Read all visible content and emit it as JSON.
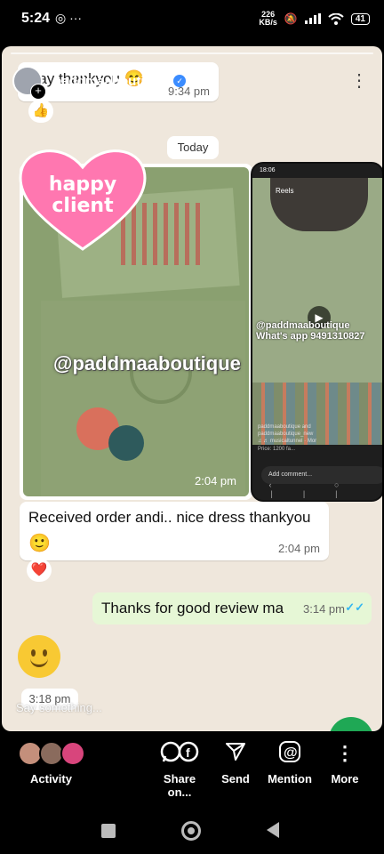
{
  "status_bar": {
    "time": "5:24",
    "left_icons": "◎ ···",
    "net_speed_value": "226",
    "net_speed_unit": "KB/s",
    "battery": "41"
  },
  "story_header": {
    "username": "paddmaaboutique",
    "time_ago": "1m",
    "verified": "✓"
  },
  "chat": {
    "prev_text": "Say thankyou",
    "prev_emoji": "😊",
    "prev_time": "9:34 pm",
    "prev_reaction": "👍",
    "date_chip": "Today",
    "sticker_text_line1": "happy",
    "sticker_text_line2": "client",
    "watermark": "@paddmaaboutique",
    "photo_time": "2:04 pm",
    "message_text": "Received order andi.. nice dress thankyou",
    "message_emoji": "🙂",
    "message_time": "2:04 pm",
    "message_reaction": "❤️",
    "outgoing_text": "Thanks for good review ma",
    "outgoing_time": "3:14 pm",
    "ticks": "✓✓",
    "emoji_time": "3:18 pm"
  },
  "embedded_screenshot": {
    "status_time": "18:06",
    "reels_label": "Reels",
    "handle_line1": "@paddmaaboutique",
    "handle_line2": "What's app 9491310827",
    "caption_line1": "paddmaaboutique and",
    "caption_line2": "paddmaaboutique_new",
    "caption_line3": "♫ ♬ musicaltunnel · Mor",
    "price": "Price: 1200 fa...",
    "comment_placeholder": "Add comment...",
    "nav_icons": "‹ ○ |||"
  },
  "reply": {
    "placeholder": "Say something..."
  },
  "actions": [
    {
      "label": "Activity"
    },
    {
      "label": "Share on..."
    },
    {
      "label": "Send"
    },
    {
      "label": "Mention"
    },
    {
      "label": "More"
    }
  ],
  "colors": {
    "viewer1": "#c48f7b",
    "viewer2": "#8a6b5d",
    "viewer3": "#d8457c",
    "sticker_heart": "#ff77b0",
    "fab": "#1fa855"
  },
  "icons": {
    "share": "whatsapp-facebook-icon",
    "send": "paper-plane-icon",
    "mention": "at-sign-icon",
    "more": "more-vert-icon"
  }
}
